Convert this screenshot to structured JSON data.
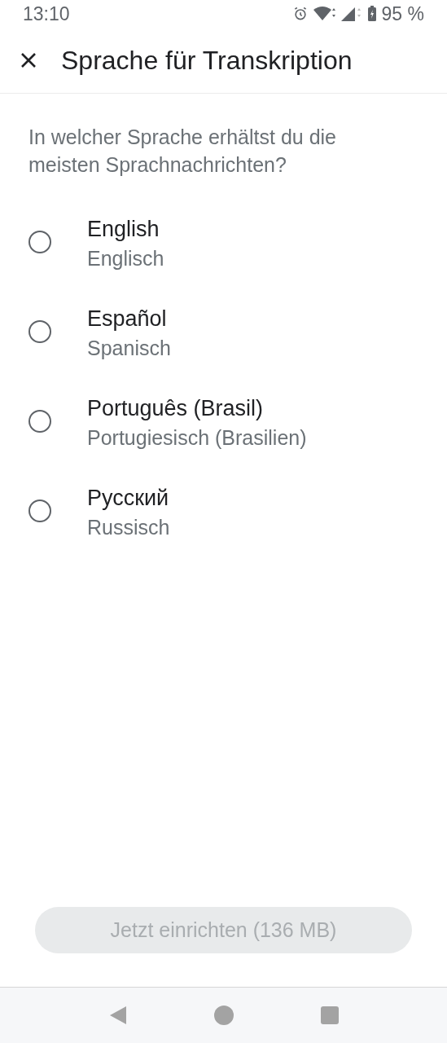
{
  "status_bar": {
    "time": "13:10",
    "battery": "95 %"
  },
  "header": {
    "title": "Sprache für Transkription"
  },
  "question": "In welcher Sprache erhältst du die meisten Sprachnachrichten?",
  "options": [
    {
      "label": "English",
      "sublabel": "Englisch",
      "selected": false
    },
    {
      "label": "Español",
      "sublabel": "Spanisch",
      "selected": false
    },
    {
      "label": "Português (Brasil)",
      "sublabel": "Portugiesisch (Brasilien)",
      "selected": false
    },
    {
      "label": "Русский",
      "sublabel": "Russisch",
      "selected": false
    }
  ],
  "action_button": {
    "label": "Jetzt einrichten (136 MB)",
    "disabled": true
  }
}
